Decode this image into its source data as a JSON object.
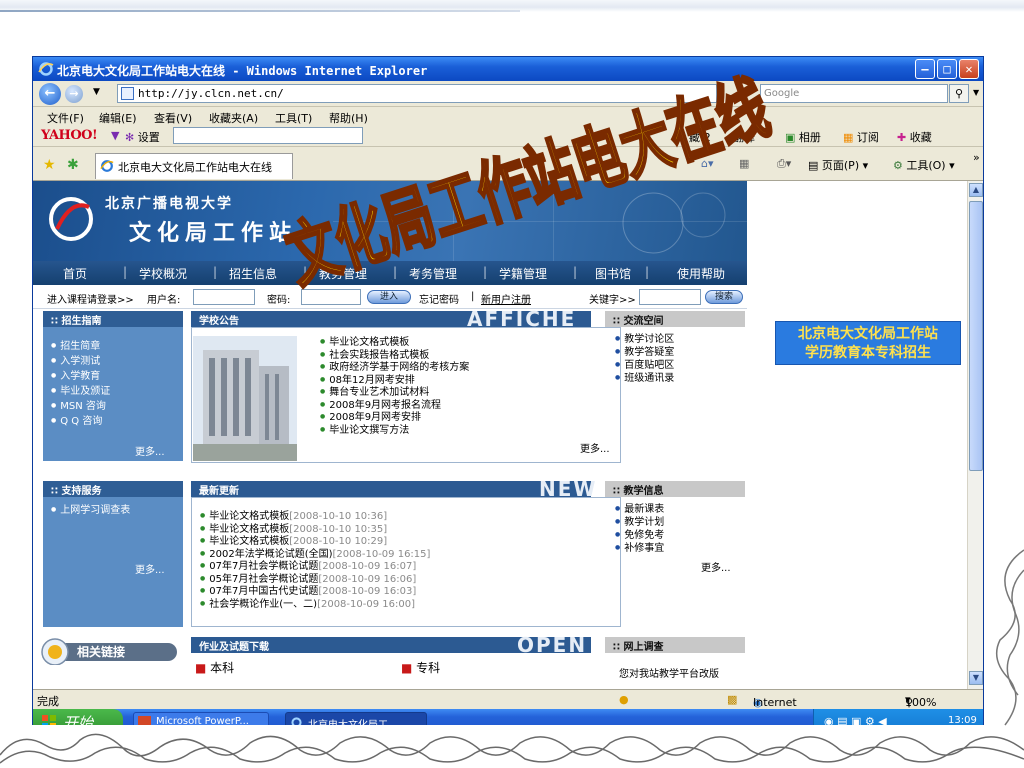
{
  "window": {
    "title": "北京电大文化局工作站电大在线 - Windows Internet Explorer",
    "address": "http://jy.clcn.net.cn/",
    "search_placeholder": "Google",
    "menu": [
      "文件(F)",
      "编辑(E)",
      "查看(V)",
      "收藏夹(A)",
      "工具(T)",
      "帮助(H)"
    ],
    "yahoo_logo": "YAHOO!",
    "yahoo_items": [
      "设置",
      "藏:2",
      "翻译",
      "相册",
      "订阅",
      "收藏"
    ],
    "tab_title": "北京电大文化局工作站电大在线",
    "toolbar_items": [
      "页面(P)",
      "工具(O)"
    ],
    "status_text": "完成",
    "zone": "Internet",
    "zoom": "100%"
  },
  "taskbar": {
    "start_label": "开始",
    "tasks": [
      "Microsoft PowerP...",
      "北京电大文化局工..."
    ],
    "clock": "13:09"
  },
  "site": {
    "school_name": "北京广播电视大学",
    "site_name_visible": "文化局工作站",
    "nav": [
      "首页",
      "学校概况",
      "招生信息",
      "教务管理",
      "考务管理",
      "学籍管理",
      "图书馆",
      "使用帮助"
    ],
    "login": {
      "prompt": "进入课程请登录>>",
      "username_label": "用户名:",
      "password_label": "密码:",
      "enter_btn": "进入",
      "forgot": "忘记密码",
      "register": "新用户注册",
      "keyword_label": "关键字>>",
      "search_btn": "搜索"
    },
    "enrollment": {
      "title": "招生指南",
      "items": [
        "招生简章",
        "入学测试",
        "入学教育",
        "毕业及颁证",
        "MSN 咨询",
        "Q Q 咨询"
      ],
      "more": "更多..."
    },
    "announcements": {
      "title": "学校公告",
      "watermark": "AFFICHE",
      "items": [
        "毕业论文格式模板",
        "社会实践报告格式模板",
        "政府经济学基于网络的考核方案",
        "08年12月网考安排",
        "舞台专业艺术加试材料",
        "2008年9月网考报名流程",
        "2008年9月网考安排",
        "毕业论文撰写方法"
      ],
      "more": "更多..."
    },
    "exchange": {
      "title": "交流空间",
      "items": [
        "教学讨论区",
        "教学答疑室",
        "百度贴吧区",
        "班级通讯录"
      ]
    },
    "support": {
      "title": "支持服务",
      "items": [
        "上网学习调查表"
      ],
      "more": "更多..."
    },
    "updates": {
      "title": "最新更新",
      "watermark": "NEW",
      "items": [
        {
          "text": "毕业论文格式模板",
          "date": "[2008-10-10 10:36]"
        },
        {
          "text": "毕业论文格式模板",
          "date": "[2008-10-10 10:35]"
        },
        {
          "text": "毕业论文格式模板",
          "date": "[2008-10-10 10:29]"
        },
        {
          "text": "2002年法学概论试题(全国)",
          "date": "[2008-10-09 16:15]"
        },
        {
          "text": "07年7月社会学概论试题",
          "date": "[2008-10-09 16:07]"
        },
        {
          "text": "05年7月社会学概论试题",
          "date": "[2008-10-09 16:06]"
        },
        {
          "text": "07年7月中国古代史试题",
          "date": "[2008-10-09 16:03]"
        },
        {
          "text": "社会学概论作业(一、二)",
          "date": "[2008-10-09 16:00]"
        }
      ]
    },
    "teaching": {
      "title": "教学信息",
      "items": [
        "最新课表",
        "教学计划",
        "免修免考",
        "补修事宜"
      ],
      "more": "更多..."
    },
    "downloads": {
      "title": "作业及试题下载",
      "watermark": "OPEN",
      "items": [
        "本科",
        "专科"
      ]
    },
    "survey": {
      "title": "网上调查",
      "text": "您对我站教学平台改版"
    },
    "links_label": "相关链接",
    "banner": [
      "北京电大文化局工作站",
      "学历教育本专科招生"
    ]
  },
  "overlay_title": "文化局工作站电大在线",
  "colors": {
    "title_blue": "#0c49c2",
    "header_blue": "#2b68ad",
    "overlay_gold": "#f6d400",
    "overlay_outline": "#7a2a00"
  }
}
